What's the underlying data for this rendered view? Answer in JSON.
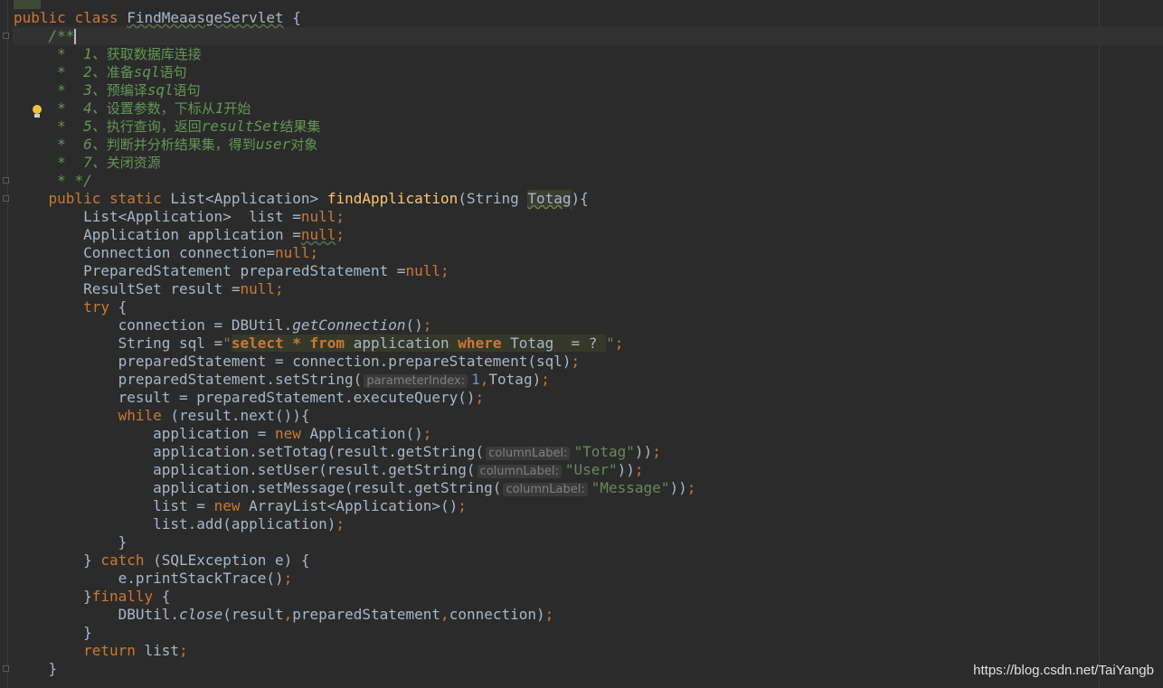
{
  "code": {
    "l1": {
      "kw1": "public",
      "kw2": "class",
      "name": "FindMeaasgeServlet",
      "rest": " {"
    },
    "c_open": "/**",
    "c1": {
      "star": "*  1、",
      "text": "获取数据库连接"
    },
    "c2": {
      "star": "*  2、",
      "text": "准备",
      "em": "sql",
      "text2": "语句"
    },
    "c3": {
      "star": "*  3、",
      "text": "预编译",
      "em": "sql",
      "text2": "语句"
    },
    "c4": {
      "star": "*  4、",
      "text": "设置参数，下标从",
      "em": "1",
      "text2": "开始"
    },
    "c5": {
      "star": "*  5、",
      "text": "执行查询，返回",
      "em": "resultSet",
      "text2": "结果集"
    },
    "c6": {
      "star": "*  6、",
      "text": "判断并分析结果集，得到",
      "em": "user",
      "text2": "对象"
    },
    "c7": {
      "star": "*  7、",
      "text": "关闭资源"
    },
    "c_close": "* */",
    "sig": {
      "kw1": "public",
      "kw2": "static",
      "type": "List<Application>",
      "name": "findApplication",
      "p1": "(String ",
      "param": "Totag",
      "p2": "){"
    },
    "d1": {
      "a": "List<Application>  list =",
      "b": "null",
      "c": ";"
    },
    "d2": {
      "a": "Application application =",
      "b": "null",
      "c": ";"
    },
    "d3": {
      "a": "Connection connection=",
      "b": "null",
      "c": ";"
    },
    "d4": {
      "a": "PreparedStatement preparedStatement =",
      "b": "null",
      "c": ";"
    },
    "d5": {
      "a": "ResultSet result =",
      "b": "null",
      "c": ";"
    },
    "try": {
      "kw": "try",
      "rest": " {"
    },
    "t1": {
      "a": "connection = DBUtil.",
      "m": "getConnection",
      "b": "()",
      "c": ";"
    },
    "t2": {
      "a": "String sql =",
      "q1": "\"",
      "s1": "select",
      "s2": " * ",
      "s3": "from",
      "s4": " application ",
      "s5": "where",
      "s6": " Totag  = ? ",
      "q2": "\"",
      "c": ";"
    },
    "t3": {
      "a": "preparedStatement = connection.prepareStatement(sql)",
      "c": ";"
    },
    "t4": {
      "a": "preparedStatement.setString(",
      "hint": "parameterIndex:",
      "n": "1",
      "comma": ",",
      "b": "Totag)",
      "c": ";"
    },
    "t5": {
      "a": "result = preparedStatement.executeQuery()",
      "c": ";"
    },
    "w": {
      "kw": "while",
      "rest": " (result.next()){"
    },
    "w1": {
      "a": "application = ",
      "kw": "new",
      "b": " Application()",
      "c": ";"
    },
    "w2": {
      "a": "application.setTotag(result.getString(",
      "hint": "columnLabel:",
      "s": "\"Totag\"",
      "b": "))",
      "c": ";"
    },
    "w3": {
      "a": "application.setUser(result.getString(",
      "hint": "columnLabel:",
      "s": "\"User\"",
      "b": "))",
      "c": ";"
    },
    "w4": {
      "a": "application.setMessage(result.getString(",
      "hint": "columnLabel:",
      "s": "\"Message\"",
      "b": "))",
      "c": ";"
    },
    "w5": {
      "a": "list = ",
      "kw": "new",
      "b": " ArrayList<Application>()",
      "c": ";"
    },
    "w6": {
      "a": "list.add(application)",
      "c": ";"
    },
    "wclose": "}",
    "catch": {
      "a": "} ",
      "kw": "catch",
      "b": " (SQLException e) {"
    },
    "cat1": {
      "a": "e.printStackTrace()",
      "c": ";"
    },
    "fin": {
      "a": "}",
      "kw": "finally",
      "b": " {"
    },
    "fin1": {
      "a": "DBUtil.",
      "m": "close",
      "b": "(result",
      "c1": ",",
      "b2": "preparedStatement",
      "c2": ",",
      "b3": "connection)",
      "c": ";"
    },
    "fclose": "}",
    "ret": {
      "kw": "return",
      "b": " list",
      "c": ";"
    },
    "mclose": "}"
  },
  "watermark": "https://blog.csdn.net/TaiYangb",
  "colors": {
    "background": "#2b2b2b",
    "keyword": "#cc7832",
    "method": "#ffc66d",
    "string": "#6a8759",
    "comment": "#629755",
    "number": "#6897bb",
    "text": "#a9b7c6"
  },
  "icons": {
    "intention": "lightbulb-icon",
    "fold": "fold-marker-icon"
  }
}
